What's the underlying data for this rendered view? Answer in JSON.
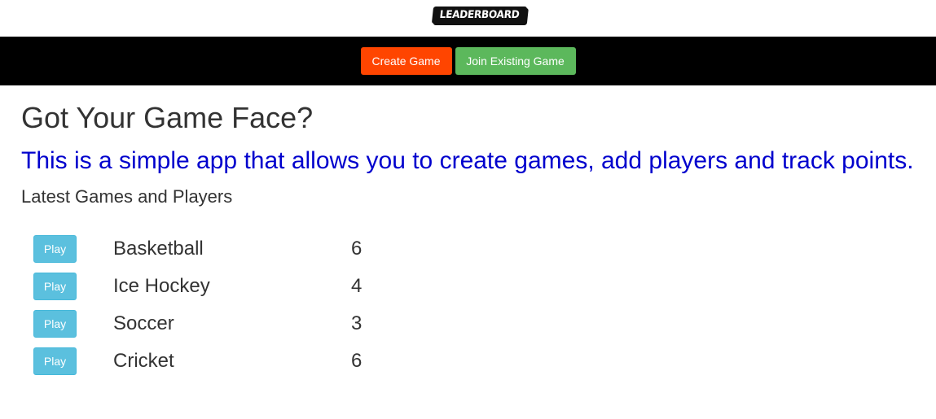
{
  "header": {
    "logo_text": "LEADERBOARD"
  },
  "nav": {
    "create_label": "Create Game",
    "join_label": "Join Existing Game"
  },
  "main": {
    "title": "Got Your Game Face?",
    "tagline": "This is a simple app that allows you to create games, add players and track points.",
    "section_heading": "Latest Games and Players",
    "play_label": "Play",
    "games": [
      {
        "name": "Basketball",
        "players": "6"
      },
      {
        "name": "Ice Hockey",
        "players": "4"
      },
      {
        "name": "Soccer",
        "players": "3"
      },
      {
        "name": "Cricket",
        "players": "6"
      }
    ]
  },
  "colors": {
    "create_button": "#ff4500",
    "join_button": "#5cb85c",
    "play_button": "#5bc0de",
    "tagline": "#0000cd",
    "navbar": "#000000"
  }
}
